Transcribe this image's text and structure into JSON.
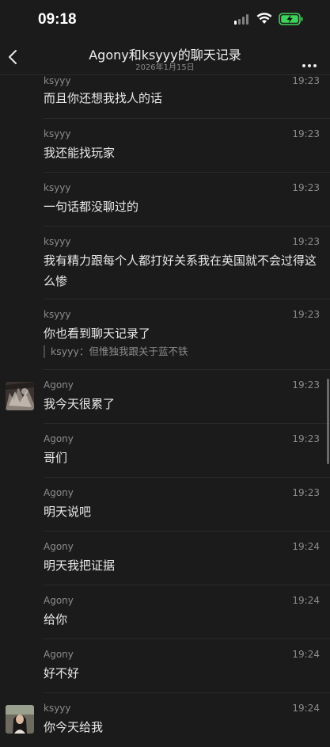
{
  "status_bar": {
    "time": "09:18"
  },
  "nav": {
    "title": "Agony和ksyyy的聊天记录",
    "subtitle": "2026年1月15日"
  },
  "messages": [
    {
      "sender": "ksyyy",
      "time": "19:23",
      "text": "而且你还想我找人的话"
    },
    {
      "sender": "ksyyy",
      "time": "19:23",
      "text": "我还能找玩家"
    },
    {
      "sender": "ksyyy",
      "time": "19:23",
      "text": "一句话都没聊过的"
    },
    {
      "sender": "ksyyy",
      "time": "19:23",
      "text": "我有精力跟每个人都打好关系我在英国就不会过得这么惨"
    },
    {
      "sender": "ksyyy",
      "time": "19:23",
      "text": "你也看到聊天记录了",
      "quote": "ksyyy：但惟独我跟关于蓝不铁"
    },
    {
      "sender": "Agony",
      "time": "19:23",
      "text": "我今天很累了"
    },
    {
      "sender": "Agony",
      "time": "19:23",
      "text": "哥们"
    },
    {
      "sender": "Agony",
      "time": "19:23",
      "text": "明天说吧"
    },
    {
      "sender": "Agony",
      "time": "19:24",
      "text": "明天我把证据"
    },
    {
      "sender": "Agony",
      "time": "19:24",
      "text": "给你"
    },
    {
      "sender": "Agony",
      "time": "19:24",
      "text": "好不好"
    },
    {
      "sender": "ksyyy",
      "time": "19:24",
      "text": "你今天给我"
    }
  ]
}
